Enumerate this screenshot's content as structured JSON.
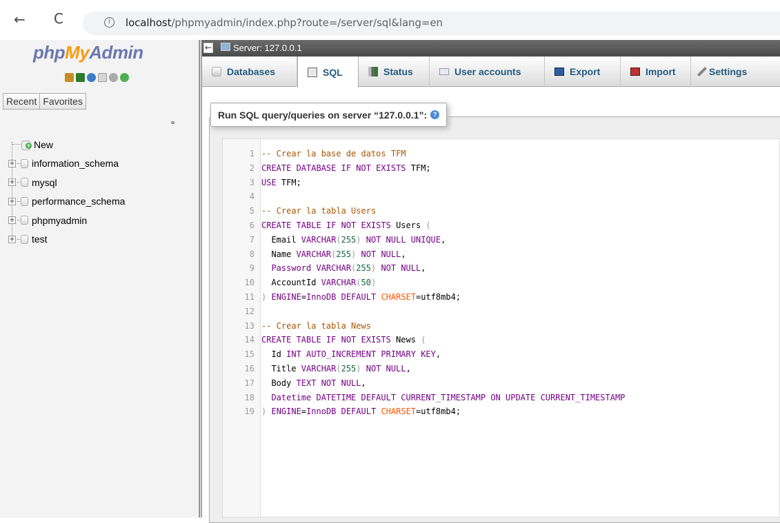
{
  "browser": {
    "back": "←",
    "reload": "C",
    "info": "i",
    "url_prefix": "localhost",
    "url_rest": "/phpmyadmin/index.php?route=/server/sql&lang=en"
  },
  "logo": {
    "php": "php",
    "my": "My",
    "admin": "Admin"
  },
  "nav_tabs": {
    "recent": "Recent",
    "favorites": "Favorites"
  },
  "tree": {
    "new": "New",
    "dbs": [
      "information_schema",
      "mysql",
      "performance_schema",
      "phpmyadmin",
      "test"
    ]
  },
  "serverbar": {
    "collapse": "←",
    "title": "Server: 127.0.0.1"
  },
  "tabs": {
    "databases": "Databases",
    "sql": "SQL",
    "status": "Status",
    "user_accounts": "User accounts",
    "export": "Export",
    "import": "Import",
    "settings": "Settings"
  },
  "query": {
    "legend": "Run SQL query/queries on server “127.0.0.1”:",
    "help": "?"
  },
  "editor": {
    "line_numbers": [
      "1",
      "2",
      "3",
      "4",
      "5",
      "6",
      "7",
      "8",
      "9",
      "10",
      "11",
      "12",
      "13",
      "14",
      "15",
      "16",
      "17",
      "18",
      "19"
    ]
  },
  "colors": {
    "tab_text": "#235a81",
    "logo_blue": "#6c78af",
    "logo_orange": "#f89c0e"
  }
}
